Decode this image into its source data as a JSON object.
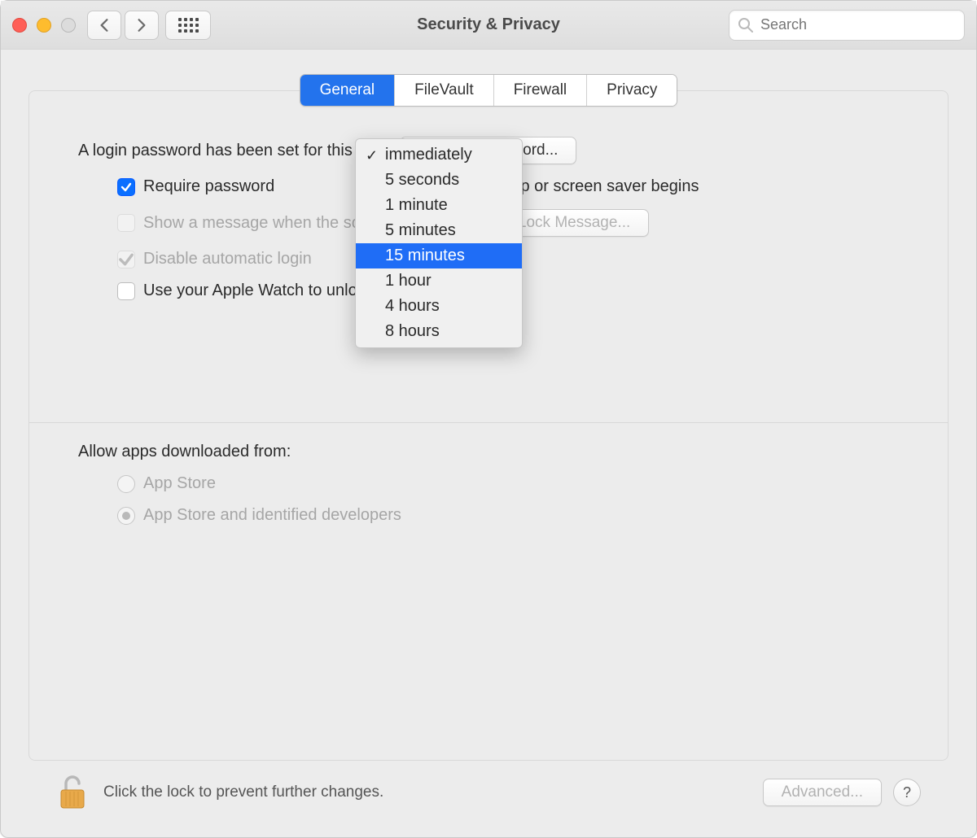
{
  "window": {
    "title": "Security & Privacy"
  },
  "search": {
    "placeholder": "Search"
  },
  "tabs": [
    {
      "label": "General",
      "active": true
    },
    {
      "label": "FileVault",
      "active": false
    },
    {
      "label": "Firewall",
      "active": false
    },
    {
      "label": "Privacy",
      "active": false
    }
  ],
  "general": {
    "login_password_text": "A login password has been set for this user",
    "change_password_btn": "Change Password...",
    "require_password_label": "Require password",
    "after_sleep_text": "after sleep or screen saver begins",
    "show_message_label": "Show a message when the screen is locked",
    "set_lock_message_btn": "Set Lock Message...",
    "disable_auto_login_label": "Disable automatic login",
    "apple_watch_label": "Use your Apple Watch to unlock apps and your Mac",
    "allow_apps_label": "Allow apps downloaded from:",
    "radio_app_store": "App Store",
    "radio_identified": "App Store and identified developers"
  },
  "dropdown": {
    "current": "immediately",
    "selected": "15 minutes",
    "options": [
      "immediately",
      "5 seconds",
      "1 minute",
      "5 minutes",
      "15 minutes",
      "1 hour",
      "4 hours",
      "8 hours"
    ]
  },
  "footer": {
    "lock_text": "Click the lock to prevent further changes.",
    "advanced_btn": "Advanced...",
    "help": "?"
  }
}
